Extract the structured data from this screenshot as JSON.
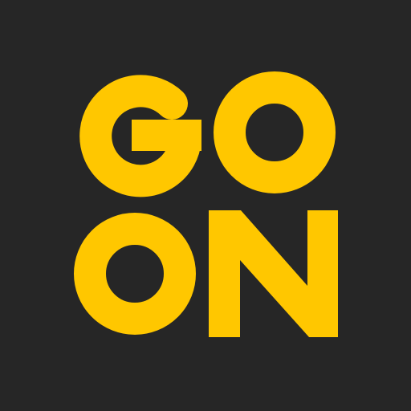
{
  "logo": {
    "text_line1": "GO",
    "text_line2": "ON",
    "colors": {
      "background": "#262626",
      "letters": "#FFC700"
    }
  }
}
